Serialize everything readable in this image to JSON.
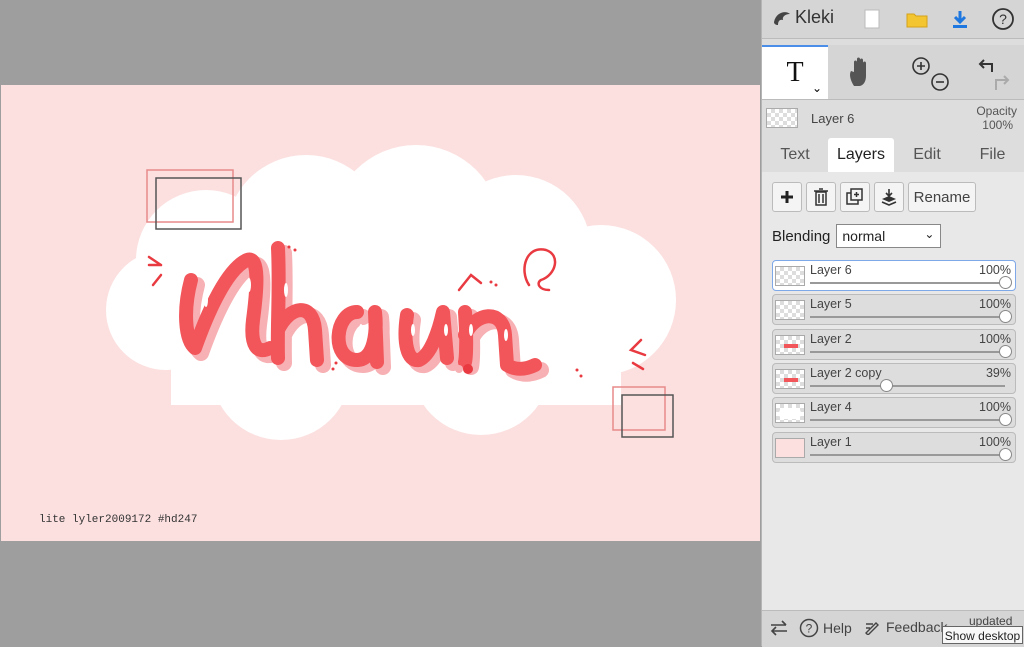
{
  "app": {
    "name": "Kleki"
  },
  "toolbar": {
    "tool_text_glyph": "T",
    "tool_caret": "⌄"
  },
  "current_layer": {
    "name": "Layer 6",
    "opacity_label": "Opacity",
    "opacity_value": "100%"
  },
  "tabs": [
    "Text",
    "Layers",
    "Edit",
    "File"
  ],
  "layer_actions": {
    "rename_label": "Rename"
  },
  "blending": {
    "label": "Blending",
    "value": "normal"
  },
  "layers": [
    {
      "name": "Layer 6",
      "opacity": "100%",
      "level": 1.0,
      "selected": true
    },
    {
      "name": "Layer 5",
      "opacity": "100%",
      "level": 1.0,
      "selected": false
    },
    {
      "name": "Layer 2",
      "opacity": "100%",
      "level": 1.0,
      "selected": false
    },
    {
      "name": "Layer 2 copy",
      "opacity": "39%",
      "level": 0.39,
      "selected": false
    },
    {
      "name": "Layer 4",
      "opacity": "100%",
      "level": 1.0,
      "selected": false
    },
    {
      "name": "Layer 1",
      "opacity": "100%",
      "level": 1.0,
      "selected": false
    }
  ],
  "canvas": {
    "watermark": "lite   lyler2009172   #hd247"
  },
  "bottom": {
    "help_label": "Help",
    "feedback_label": "Feedback",
    "updated_label": "updated"
  },
  "tooltip": {
    "text": "Show desktop"
  },
  "colors": {
    "canvas_bg": "#fce0e0",
    "text_red": "#f2555a",
    "accent_blue": "#4a8ee8"
  }
}
